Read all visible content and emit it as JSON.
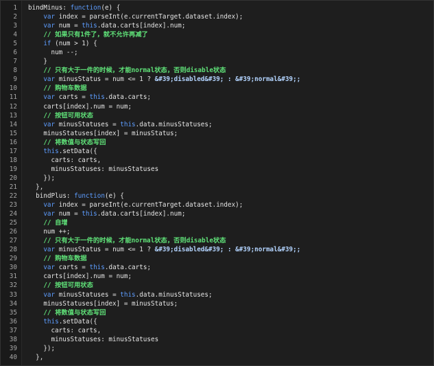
{
  "editor": {
    "lines": [
      {
        "num": "1",
        "indent": 0,
        "tokens": [
          {
            "t": "bindMinus: ",
            "c": "plain"
          },
          {
            "t": "function",
            "c": "kw"
          },
          {
            "t": "(e) {",
            "c": "plain"
          }
        ]
      },
      {
        "num": "2",
        "indent": 4,
        "tokens": [
          {
            "t": "var",
            "c": "kw"
          },
          {
            "t": " index = parseInt(e.currentTarget.dataset.index);",
            "c": "plain"
          }
        ]
      },
      {
        "num": "3",
        "indent": 4,
        "tokens": [
          {
            "t": "var",
            "c": "kw"
          },
          {
            "t": " num = ",
            "c": "plain"
          },
          {
            "t": "this",
            "c": "kw"
          },
          {
            "t": ".data.carts[index].num;",
            "c": "plain"
          }
        ]
      },
      {
        "num": "4",
        "indent": 4,
        "tokens": [
          {
            "t": "// 如果只有1件了，就不允许再减了",
            "c": "cm"
          }
        ]
      },
      {
        "num": "5",
        "indent": 4,
        "tokens": [
          {
            "t": "if",
            "c": "kw"
          },
          {
            "t": " (num > 1) {",
            "c": "plain"
          }
        ]
      },
      {
        "num": "6",
        "indent": 6,
        "tokens": [
          {
            "t": "num --;",
            "c": "plain"
          }
        ]
      },
      {
        "num": "7",
        "indent": 4,
        "tokens": [
          {
            "t": "}",
            "c": "plain"
          }
        ]
      },
      {
        "num": "8",
        "indent": 4,
        "tokens": [
          {
            "t": "// 只有大于一件的时候，才能normal状态，否则disable状态",
            "c": "cm"
          }
        ]
      },
      {
        "num": "9",
        "indent": 4,
        "tokens": [
          {
            "t": "var",
            "c": "kw"
          },
          {
            "t": " minusStatus = num <= 1 ? ",
            "c": "plain"
          },
          {
            "t": "&#39;disabled&#39; : &#39;normal&#39;;",
            "c": "str"
          }
        ]
      },
      {
        "num": "10",
        "indent": 4,
        "tokens": [
          {
            "t": "// 购物车数据",
            "c": "cm"
          }
        ]
      },
      {
        "num": "11",
        "indent": 4,
        "tokens": [
          {
            "t": "var",
            "c": "kw"
          },
          {
            "t": " carts = ",
            "c": "plain"
          },
          {
            "t": "this",
            "c": "kw"
          },
          {
            "t": ".data.carts;",
            "c": "plain"
          }
        ]
      },
      {
        "num": "12",
        "indent": 4,
        "tokens": [
          {
            "t": "carts[index].num = num;",
            "c": "plain"
          }
        ]
      },
      {
        "num": "13",
        "indent": 4,
        "tokens": [
          {
            "t": "// 按钮可用状态",
            "c": "cm"
          }
        ]
      },
      {
        "num": "14",
        "indent": 4,
        "tokens": [
          {
            "t": "var",
            "c": "kw"
          },
          {
            "t": " minusStatuses = ",
            "c": "plain"
          },
          {
            "t": "this",
            "c": "kw"
          },
          {
            "t": ".data.minusStatuses;",
            "c": "plain"
          }
        ]
      },
      {
        "num": "15",
        "indent": 4,
        "tokens": [
          {
            "t": "minusStatuses[index] = minusStatus;",
            "c": "plain"
          }
        ]
      },
      {
        "num": "16",
        "indent": 4,
        "tokens": [
          {
            "t": "// 将数值与状态写回",
            "c": "cm"
          }
        ]
      },
      {
        "num": "17",
        "indent": 4,
        "tokens": [
          {
            "t": "this",
            "c": "kw"
          },
          {
            "t": ".setData({",
            "c": "plain"
          }
        ]
      },
      {
        "num": "18",
        "indent": 6,
        "tokens": [
          {
            "t": "carts: carts,",
            "c": "plain"
          }
        ]
      },
      {
        "num": "19",
        "indent": 6,
        "tokens": [
          {
            "t": "minusStatuses: minusStatuses",
            "c": "plain"
          }
        ]
      },
      {
        "num": "20",
        "indent": 4,
        "tokens": [
          {
            "t": "});",
            "c": "plain"
          }
        ]
      },
      {
        "num": "21",
        "indent": 2,
        "tokens": [
          {
            "t": "},",
            "c": "plain"
          }
        ]
      },
      {
        "num": "22",
        "indent": 2,
        "tokens": [
          {
            "t": "bindPlus: ",
            "c": "plain"
          },
          {
            "t": "function",
            "c": "kw"
          },
          {
            "t": "(e) {",
            "c": "plain"
          }
        ]
      },
      {
        "num": "23",
        "indent": 4,
        "tokens": [
          {
            "t": "var",
            "c": "kw"
          },
          {
            "t": " index = parseInt(e.currentTarget.dataset.index);",
            "c": "plain"
          }
        ]
      },
      {
        "num": "24",
        "indent": 4,
        "tokens": [
          {
            "t": "var",
            "c": "kw"
          },
          {
            "t": " num = ",
            "c": "plain"
          },
          {
            "t": "this",
            "c": "kw"
          },
          {
            "t": ".data.carts[index].num;",
            "c": "plain"
          }
        ]
      },
      {
        "num": "25",
        "indent": 4,
        "tokens": [
          {
            "t": "// 自增",
            "c": "cm"
          }
        ]
      },
      {
        "num": "26",
        "indent": 4,
        "tokens": [
          {
            "t": "num ++;",
            "c": "plain"
          }
        ]
      },
      {
        "num": "27",
        "indent": 4,
        "tokens": [
          {
            "t": "// 只有大于一件的时候，才能normal状态，否则disable状态",
            "c": "cm"
          }
        ]
      },
      {
        "num": "28",
        "indent": 4,
        "tokens": [
          {
            "t": "var",
            "c": "kw"
          },
          {
            "t": " minusStatus = num <= 1 ? ",
            "c": "plain"
          },
          {
            "t": "&#39;disabled&#39; : &#39;normal&#39;;",
            "c": "str"
          }
        ]
      },
      {
        "num": "29",
        "indent": 4,
        "tokens": [
          {
            "t": "// 购物车数据",
            "c": "cm"
          }
        ]
      },
      {
        "num": "30",
        "indent": 4,
        "tokens": [
          {
            "t": "var",
            "c": "kw"
          },
          {
            "t": " carts = ",
            "c": "plain"
          },
          {
            "t": "this",
            "c": "kw"
          },
          {
            "t": ".data.carts;",
            "c": "plain"
          }
        ]
      },
      {
        "num": "31",
        "indent": 4,
        "tokens": [
          {
            "t": "carts[index].num = num;",
            "c": "plain"
          }
        ]
      },
      {
        "num": "32",
        "indent": 4,
        "tokens": [
          {
            "t": "// 按钮可用状态",
            "c": "cm"
          }
        ]
      },
      {
        "num": "33",
        "indent": 4,
        "tokens": [
          {
            "t": "var",
            "c": "kw"
          },
          {
            "t": " minusStatuses = ",
            "c": "plain"
          },
          {
            "t": "this",
            "c": "kw"
          },
          {
            "t": ".data.minusStatuses;",
            "c": "plain"
          }
        ]
      },
      {
        "num": "34",
        "indent": 4,
        "tokens": [
          {
            "t": "minusStatuses[index] = minusStatus;",
            "c": "plain"
          }
        ]
      },
      {
        "num": "35",
        "indent": 4,
        "tokens": [
          {
            "t": "// 将数值与状态写回",
            "c": "cm"
          }
        ]
      },
      {
        "num": "36",
        "indent": 4,
        "tokens": [
          {
            "t": "this",
            "c": "kw"
          },
          {
            "t": ".setData({",
            "c": "plain"
          }
        ]
      },
      {
        "num": "37",
        "indent": 6,
        "tokens": [
          {
            "t": "carts: carts,",
            "c": "plain"
          }
        ]
      },
      {
        "num": "38",
        "indent": 6,
        "tokens": [
          {
            "t": "minusStatuses: minusStatuses",
            "c": "plain"
          }
        ]
      },
      {
        "num": "39",
        "indent": 4,
        "tokens": [
          {
            "t": "});",
            "c": "plain"
          }
        ]
      },
      {
        "num": "40",
        "indent": 2,
        "tokens": [
          {
            "t": "},",
            "c": "plain"
          }
        ]
      }
    ]
  },
  "colors": {
    "background": "#1e1e1e",
    "keyword": "#5d9dff",
    "comment": "#5fe078",
    "string": "#b3d4ff",
    "text": "#e6e6e6",
    "line_number": "#a7a7a7"
  }
}
